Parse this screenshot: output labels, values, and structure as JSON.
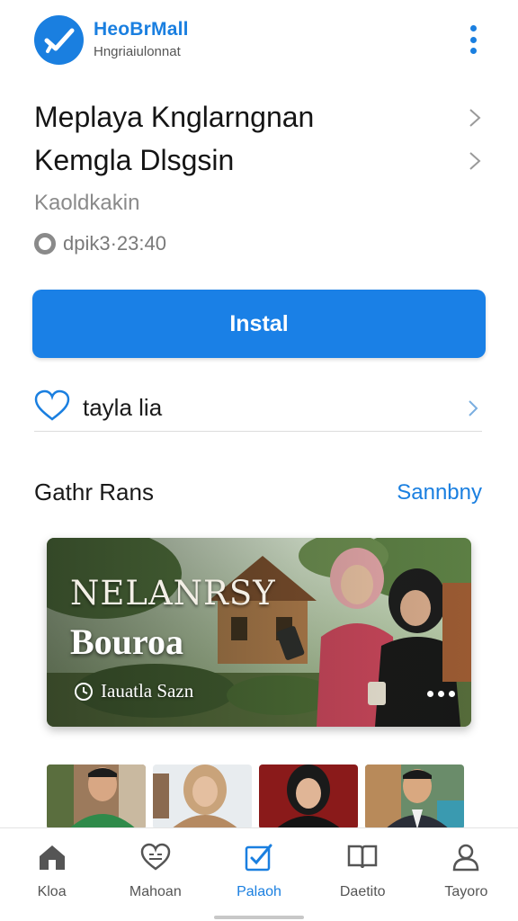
{
  "header": {
    "brand_name": "HeoBrMall",
    "brand_tagline": "Hngriaiulonnat",
    "logo_icon": "checkmark-logo-icon",
    "menu_icon": "kebab-menu-icon",
    "accent_color": "#1a7fe0"
  },
  "app": {
    "title_line1": "Meplaya Knglarngnan",
    "title_line2": "Kemgla Dlsgsin",
    "subtitle": "Kaoldkakin",
    "meta": "dpik3·23:40"
  },
  "install": {
    "label": "Instal"
  },
  "wishlist": {
    "label": "tayla lia",
    "icon": "heart-outline-icon"
  },
  "gallery": {
    "title": "Gathr Rans",
    "see_all": "Sannbny",
    "featured": {
      "kicker": "NELANRSY",
      "title": "Bouroa",
      "meta": "Iauatla Sazn"
    },
    "thumbnails": [
      "portrait-man-green",
      "portrait-woman-hijab",
      "portrait-woman-black-hijab",
      "portrait-man-suit"
    ]
  },
  "bottom_nav": {
    "items": [
      {
        "label": "Kloa",
        "icon": "home-icon",
        "active": false
      },
      {
        "label": "Mahoan",
        "icon": "heart-gift-icon",
        "active": false
      },
      {
        "label": "Palaoh",
        "icon": "edit-check-icon",
        "active": true
      },
      {
        "label": "Daetito",
        "icon": "book-icon",
        "active": false
      },
      {
        "label": "Tayoro",
        "icon": "person-icon",
        "active": false
      }
    ]
  }
}
